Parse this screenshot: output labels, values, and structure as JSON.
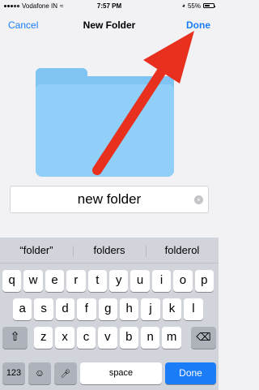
{
  "status": {
    "carrier": "Vodafone IN",
    "time": "7:57 PM",
    "battery": "55%",
    "battery_level": 0.55
  },
  "nav": {
    "cancel": "Cancel",
    "title": "New Folder",
    "done": "Done"
  },
  "name_field": {
    "value": "new folder"
  },
  "keyboard": {
    "suggestions": [
      "“folder”",
      "folders",
      "folderol"
    ],
    "row1": [
      "q",
      "w",
      "e",
      "r",
      "t",
      "y",
      "u",
      "i",
      "o",
      "p"
    ],
    "row2": [
      "a",
      "s",
      "d",
      "f",
      "g",
      "h",
      "j",
      "k",
      "l"
    ],
    "row3": [
      "z",
      "x",
      "c",
      "v",
      "b",
      "n",
      "m"
    ],
    "numbers_key": "123",
    "space_key": "space",
    "done_key": "Done"
  },
  "colors": {
    "accent": "#1a7cf7",
    "folder": "#8fcff8",
    "annotation_arrow": "#e8301e"
  },
  "icons": {
    "shift": "shift-icon",
    "backspace": "backspace-icon",
    "emoji": "emoji-icon",
    "microphone": "microphone-icon",
    "clear": "clear-icon",
    "wifi": "wifi-icon"
  }
}
